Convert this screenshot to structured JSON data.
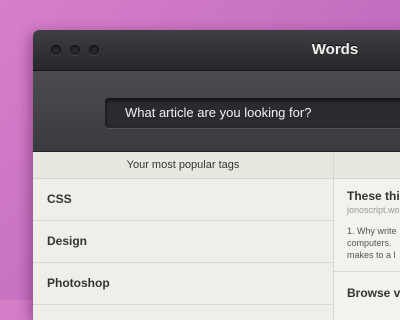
{
  "window": {
    "title": "Words",
    "controls": [
      "close-button",
      "minimize-button",
      "zoom-button"
    ]
  },
  "search": {
    "placeholder": "What article are you looking for?"
  },
  "tags": {
    "header": "Your most popular tags",
    "items": [
      "CSS",
      "Design",
      "Photoshop"
    ]
  },
  "articles": [
    {
      "title": "These thi",
      "source": "jonoscript.wo",
      "excerpt_line1": "1. Why write",
      "excerpt_line2": "computers.",
      "excerpt_line3": "makes to a l"
    },
    {
      "title": "Browse vs"
    }
  ],
  "colors": {
    "background": "#c872c2",
    "titlebar": "#2f3033",
    "content": "#efeee8"
  }
}
